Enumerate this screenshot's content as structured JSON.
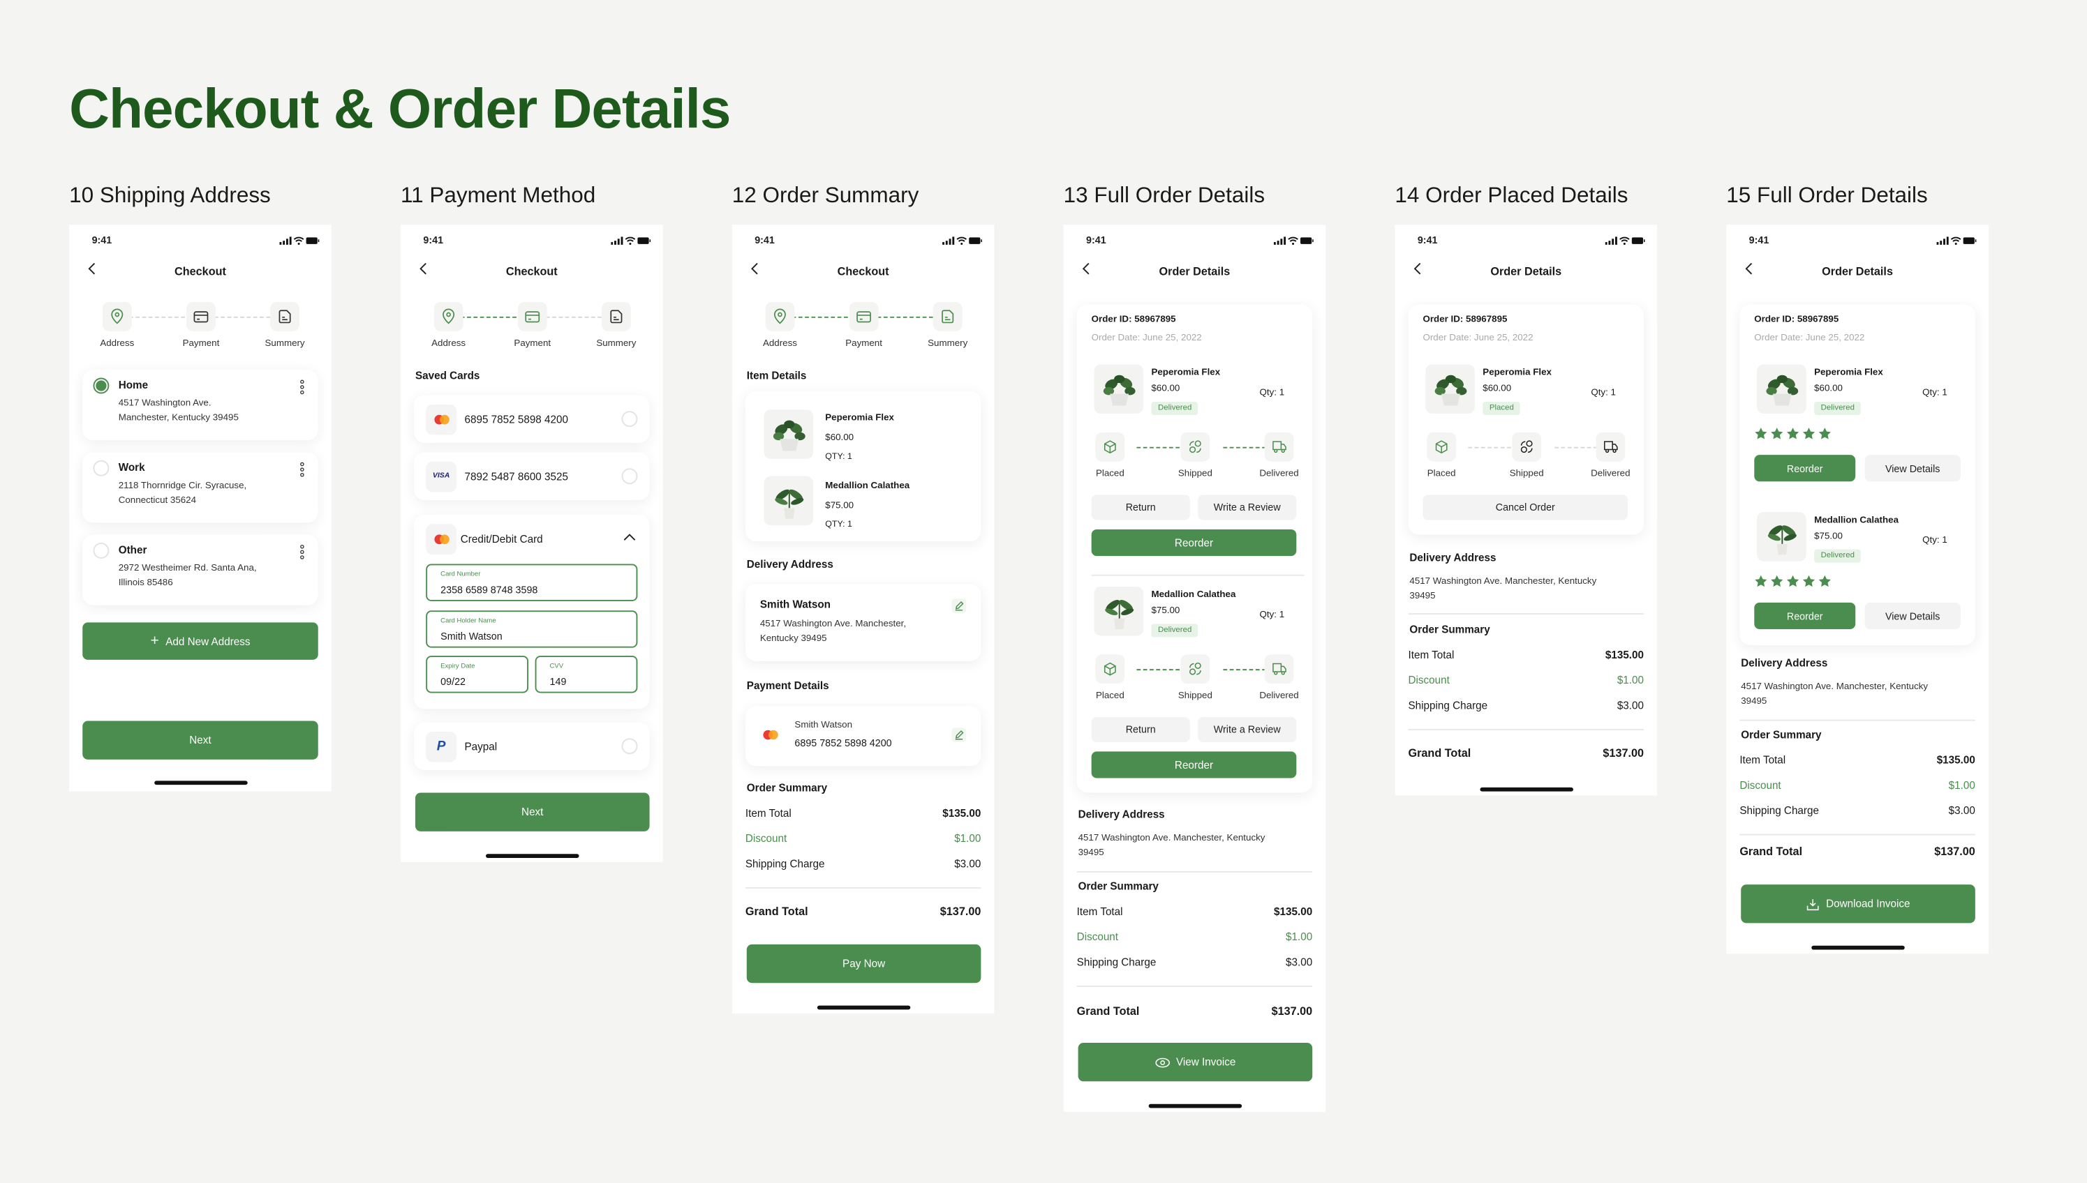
{
  "page_title": "Checkout & Order Details",
  "colors": {
    "primary_green": "#4b8d4e",
    "title_green": "#1d5a1c",
    "background": "#f4f5f2"
  },
  "status_time": "9:41",
  "steps": [
    "Address",
    "Payment",
    "Summery"
  ],
  "tracker": [
    "Placed",
    "Shipped",
    "Delivered"
  ],
  "screen_labels": [
    "10 Shipping Address",
    "11 Payment Method",
    "12 Order Summary",
    "13 Full Order Details",
    "14 Order Placed Details",
    "15 Full Order Details"
  ],
  "titles": {
    "checkout": "Checkout",
    "order_details": "Order Details"
  },
  "shipping": {
    "addresses": [
      {
        "name": "Home",
        "line1": "4517 Washington Ave.",
        "line2": "Manchester, Kentucky 39495",
        "selected": true
      },
      {
        "name": "Work",
        "line1": "2118 Thornridge Cir. Syracuse,",
        "line2": "Connecticut 35624",
        "selected": false
      },
      {
        "name": "Other",
        "line1": "2972 Westheimer Rd. Santa Ana,",
        "line2": "Illinois 85486",
        "selected": false
      }
    ],
    "add_button": "Add New Address",
    "next": "Next"
  },
  "payment": {
    "saved_cards_label": "Saved Cards",
    "cards": [
      {
        "number": "6895 7852 5898 4200",
        "brand": "mastercard"
      },
      {
        "number": "7892 5487 8600 3525",
        "brand": "visa",
        "brand_label": "VISA"
      }
    ],
    "credit_card_label": "Credit/Debit Card",
    "fields": {
      "card_number_label": "Card Number",
      "card_number": "2358 6589 8748 3598",
      "holder_label": "Card Holder Name",
      "holder": "Smith Watson",
      "expiry_label": "Expiry Date",
      "expiry": "09/22",
      "cvv_label": "CVV",
      "cvv": "149"
    },
    "paypal": "Paypal",
    "next": "Next"
  },
  "products": [
    {
      "name": "Peperomia Flex",
      "price": "$60.00",
      "qty_upper": "QTY: 1",
      "qty": "Qty: 1"
    },
    {
      "name": "Medallion Calathea",
      "price": "$75.00",
      "qty_upper": "QTY: 1",
      "qty": "Qty: 1"
    }
  ],
  "summary_screen": {
    "item_details_label": "Item Details",
    "delivery_address_label": "Delivery Address",
    "delivery_name": "Smith Watson",
    "delivery_line1": "4517 Washington Ave. Manchester,",
    "delivery_line2": "Kentucky 39495",
    "payment_details_label": "Payment Details",
    "payment_name": "Smith Watson",
    "payment_number": "6895 7852 5898 4200",
    "pay_now": "Pay Now"
  },
  "order": {
    "id": "Order ID: 58967895",
    "date": "Order Date: June 25, 2022",
    "status_delivered": "Delivered",
    "status_placed": "Placed",
    "return": "Return",
    "write_review": "Write a Review",
    "reorder": "Reorder",
    "view_details": "View Details",
    "cancel_order": "Cancel Order",
    "rating": 5,
    "delivery_address_label": "Delivery Address",
    "address_line1": "4517 Washington Ave. Manchester, Kentucky",
    "address_line2": "39495",
    "view_invoice": "View Invoice",
    "download_invoice": "Download Invoice"
  },
  "order_summary": {
    "label": "Order Summary",
    "item_total_label": "Item Total",
    "item_total": "$135.00",
    "discount_label": "Discount",
    "discount": "$1.00",
    "shipping_label": "Shipping Charge",
    "shipping": "$3.00",
    "grand_total_label": "Grand Total",
    "grand_total": "$137.00"
  }
}
